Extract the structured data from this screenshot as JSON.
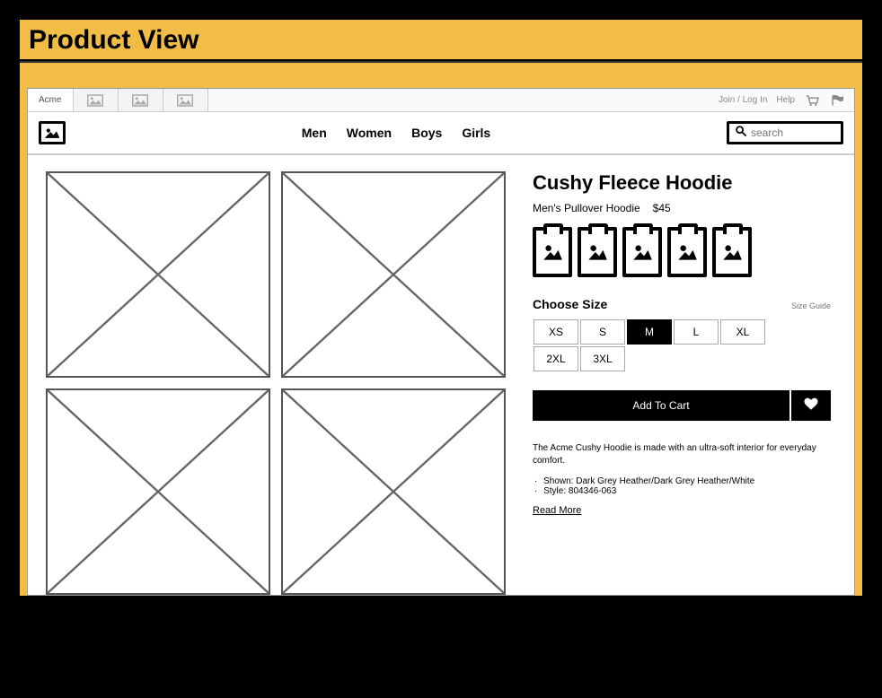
{
  "page": {
    "title": "Product View"
  },
  "topbar": {
    "brand_tab": "Acme",
    "join_login": "Join / Log In",
    "help": "Help"
  },
  "nav": {
    "categories": [
      "Men",
      "Women",
      "Boys",
      "Girls"
    ],
    "search_placeholder": "search"
  },
  "product": {
    "title": "Cushy Fleece Hoodie",
    "subtitle": "Men's Pullover Hoodie",
    "price": "$45",
    "size_label": "Choose Size",
    "size_guide": "Size Guide",
    "sizes": [
      {
        "label": "XS",
        "selected": false
      },
      {
        "label": "S",
        "selected": false
      },
      {
        "label": "M",
        "selected": true
      },
      {
        "label": "L",
        "selected": false
      },
      {
        "label": "XL",
        "selected": false
      },
      {
        "label": "2XL",
        "selected": false
      },
      {
        "label": "3XL",
        "selected": false
      }
    ],
    "add_to_cart": "Add To Cart",
    "description": "The Acme Cushy Hoodie is made with an ultra-soft interior for everyday comfort.",
    "bullets": [
      "Shown: Dark Grey Heather/Dark Grey Heather/White",
      "Style: 804346-063"
    ],
    "read_more": "Read More"
  }
}
